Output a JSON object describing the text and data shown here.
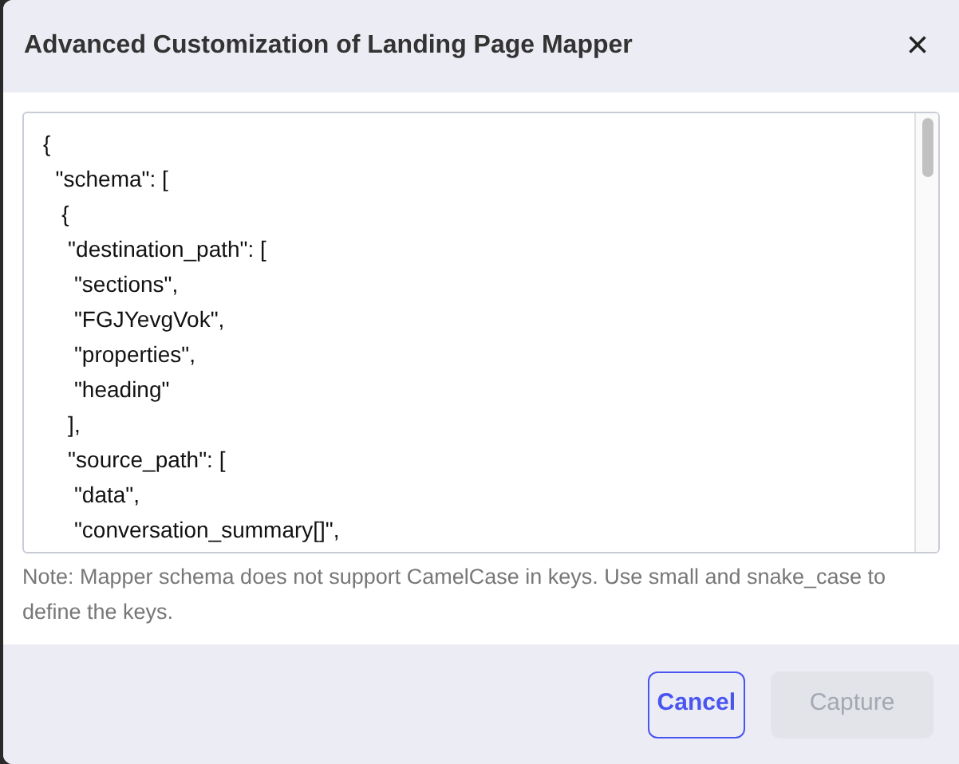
{
  "dialog": {
    "title": "Advanced Customization of Landing Page Mapper",
    "close_icon": "×"
  },
  "editor": {
    "lines": [
      "{",
      "  \"schema\": [",
      "   {",
      "    \"destination_path\": [",
      "     \"sections\",",
      "     \"FGJYevgVok\",",
      "     \"properties\",",
      "     \"heading\"",
      "    ],",
      "    \"source_path\": [",
      "     \"data\",",
      "     \"conversation_summary[]\","
    ]
  },
  "note": "Note: Mapper schema does not support CamelCase in keys. Use small and snake_case to define the keys.",
  "buttons": [
    {
      "label": "Cancel",
      "disabled": false
    },
    {
      "label": "Capture",
      "disabled": true
    }
  ]
}
